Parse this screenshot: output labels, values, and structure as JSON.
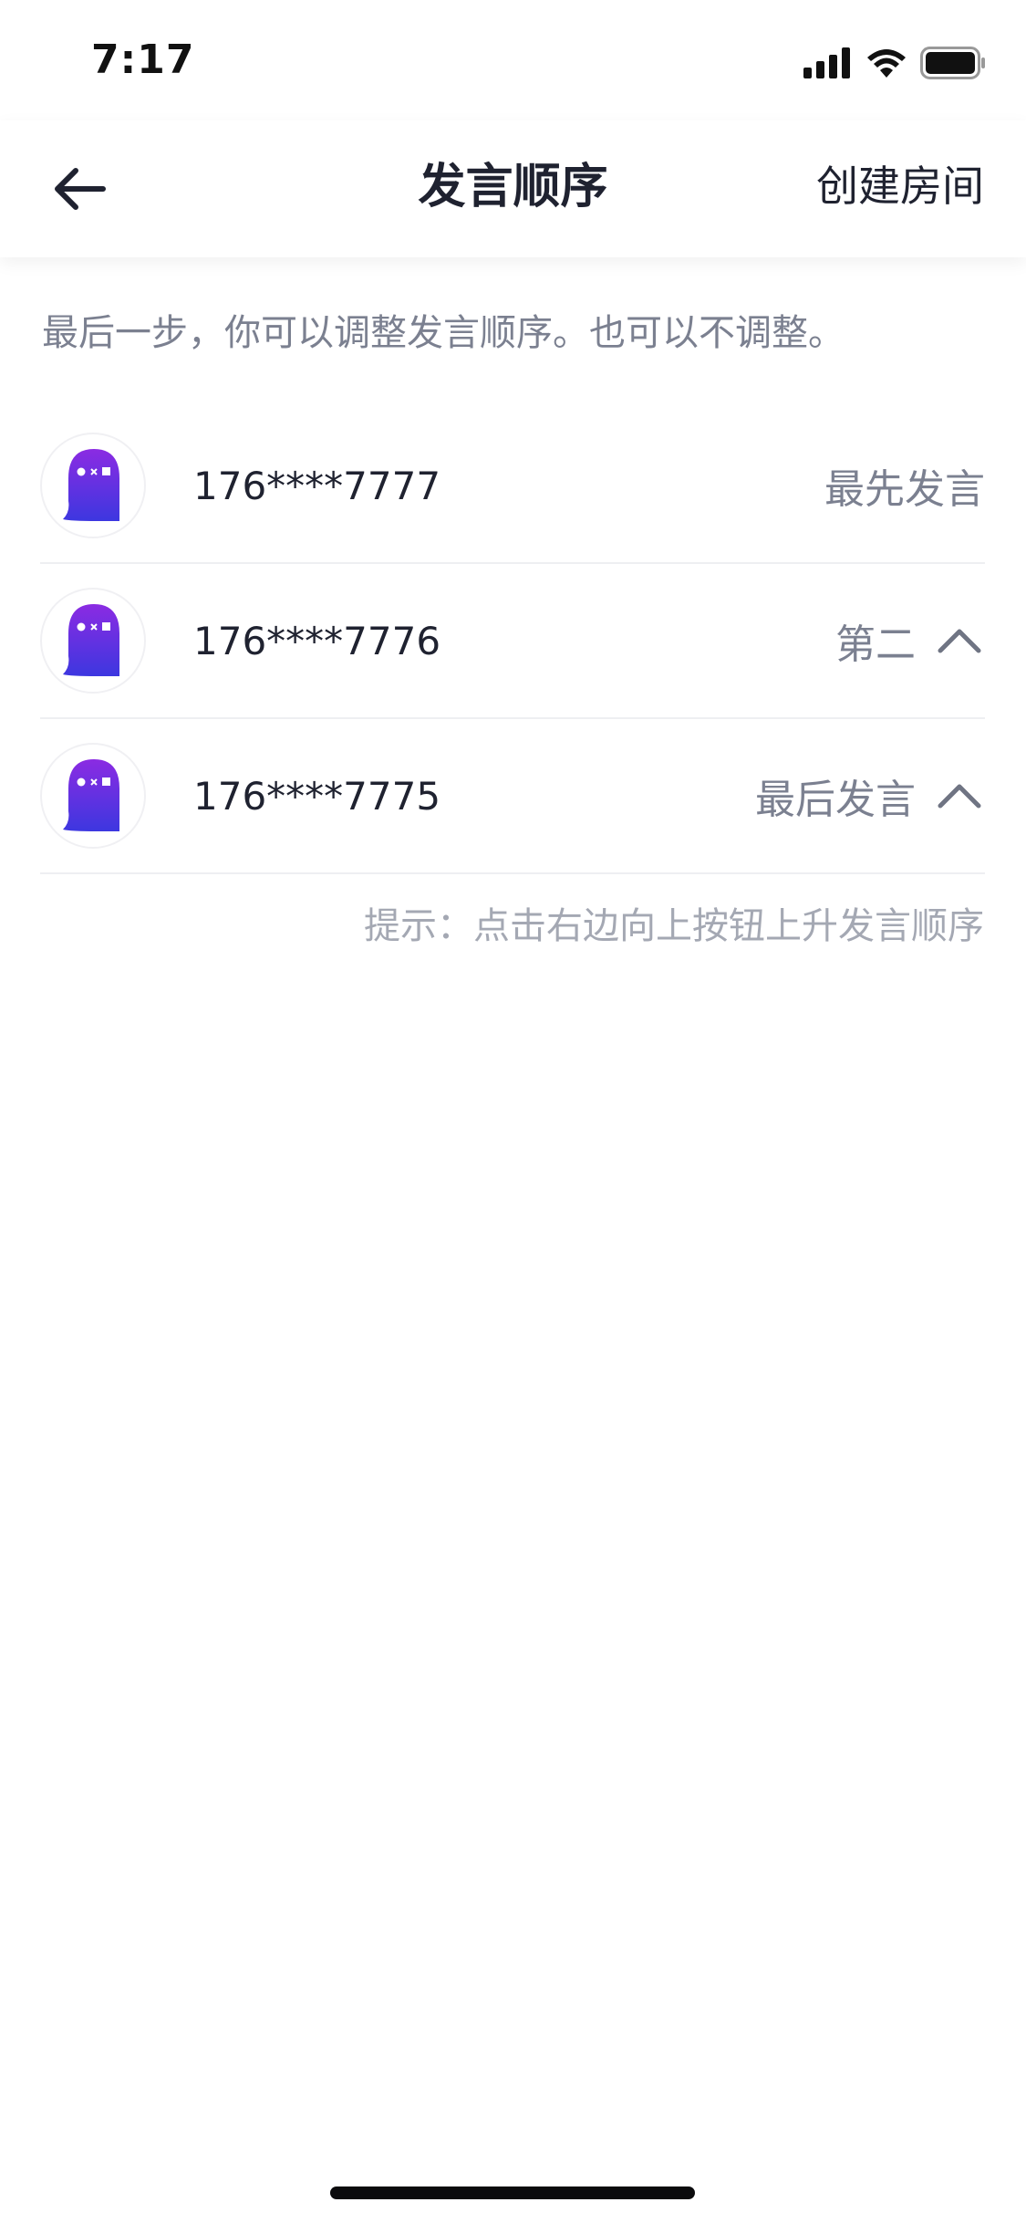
{
  "status_bar": {
    "time": "7:17",
    "icons": [
      "signal-icon",
      "wifi-icon",
      "battery-icon"
    ]
  },
  "nav": {
    "back_icon": "back-arrow-icon",
    "title": "发言顺序",
    "action_label": "创建房间"
  },
  "intro": "最后一步，你可以调整发言顺序。也可以不调整。",
  "players": [
    {
      "name": "176****7777",
      "order_label": "最先发言",
      "has_up_button": false
    },
    {
      "name": "176****7776",
      "order_label": "第二",
      "has_up_button": true
    },
    {
      "name": "176****7775",
      "order_label": "最后发言",
      "has_up_button": true
    }
  ],
  "hint": "提示：点击右边向上按钮上升发言顺序",
  "colors": {
    "avatar_gradient_top": "#8b2be2",
    "avatar_gradient_bottom": "#3d37e0",
    "text_primary": "#1f2230",
    "text_secondary": "#7b8090",
    "text_hint": "#a4a8b3"
  }
}
